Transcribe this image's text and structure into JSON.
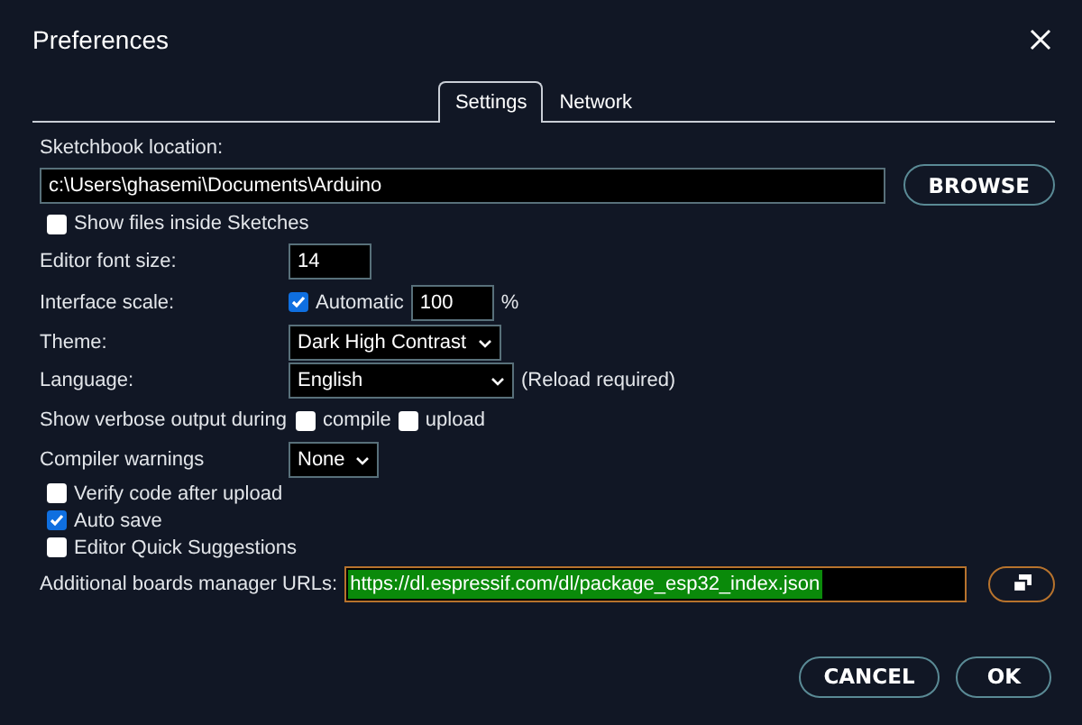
{
  "window": {
    "title": "Preferences"
  },
  "tabs": [
    {
      "label": "Settings",
      "selected": true
    },
    {
      "label": "Network",
      "selected": false
    }
  ],
  "sketchbook": {
    "label": "Sketchbook location:",
    "value": "c:\\Users\\ghasemi\\Documents\\Arduino",
    "button": "BROWSE"
  },
  "show_files": {
    "label": "Show files inside Sketches",
    "checked": false
  },
  "settings": [
    {
      "kind": "input",
      "label": "Editor font size:",
      "value": "14"
    },
    {
      "kind": "scale",
      "label": "Interface scale:",
      "checkbox": {
        "label": "Automatic",
        "checked": true
      },
      "value": "100",
      "unit": "%"
    },
    {
      "kind": "select",
      "label": "Theme:",
      "value": "Dark High Contrast"
    },
    {
      "kind": "select",
      "label": "Language:",
      "value": "English",
      "note": "(Reload required)"
    },
    {
      "kind": "checks",
      "label": "Show verbose output during",
      "options": [
        {
          "label": "compile",
          "checked": false
        },
        {
          "label": "upload",
          "checked": false
        }
      ]
    },
    {
      "kind": "select",
      "label": "Compiler warnings",
      "value": "None"
    }
  ],
  "options": [
    {
      "label": "Verify code after upload",
      "checked": false
    },
    {
      "label": "Auto save",
      "checked": true
    },
    {
      "label": "Editor Quick Suggestions",
      "checked": false
    }
  ],
  "urls": {
    "label": "Additional boards manager URLs:",
    "value": "https://dl.espressif.com/dl/package_esp32_index.json"
  },
  "buttons": [
    {
      "label": "CANCEL"
    },
    {
      "label": "OK"
    }
  ]
}
